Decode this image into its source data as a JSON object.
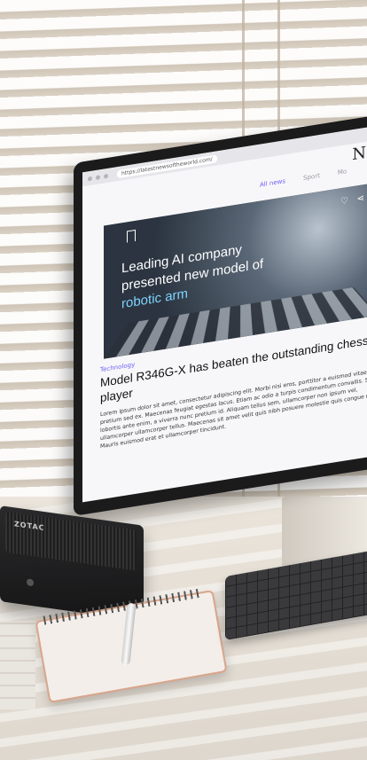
{
  "browser": {
    "url": "https://latestnewsoftheworld.com/"
  },
  "site": {
    "logo": "New",
    "nav": {
      "active": "All news",
      "item2": "Sport",
      "item3": "Mo"
    }
  },
  "hero": {
    "headline_line1": "Leading AI company",
    "headline_line2": "presented new model of",
    "headline_highlight": "robotic arm"
  },
  "article": {
    "category": "Technology",
    "title": "Model R346G-X has beaten the outstanding chess player",
    "body": "Lorem ipsum dolor sit amet, consectetur adipiscing elit. Morbi nisi eros, porttitor a euismod vitae, pretium sed ex. Maecenas feugiat egestas lacus. Etiam ac odio a turpis condimentum convallis. Sed lobortis ante enim, a viverra nunc pretium id. Aliquam tellus sem, ullamcorper non ipsum vel, ullamcorper ullamcorper tellus. Maecenas sit amet velit quis nibh posuere molestie quis congue nisl. Mauris euismod erat et ullamcorper tincidunt."
  },
  "device": {
    "brand": "ZOTAC"
  }
}
